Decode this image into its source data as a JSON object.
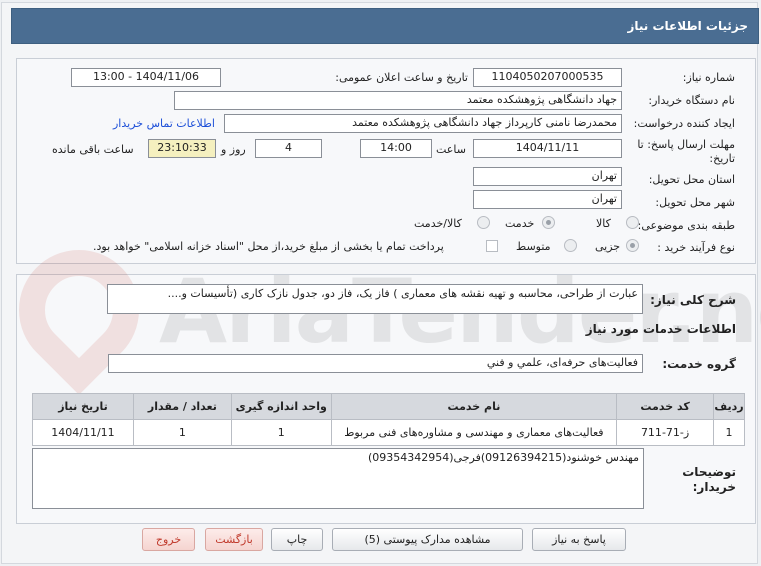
{
  "header": {
    "title": "جزئیات اطلاعات نیاز"
  },
  "fields": {
    "need_number_label": "شماره نیاز:",
    "need_number": "1104050207000535",
    "announce_label": "تاریخ و ساعت اعلان عمومی:",
    "announce_value": "1404/11/06 - 13:00",
    "buyer_org_label": "نام دستگاه خریدار:",
    "buyer_org": "جهاد دانشگاهی پژوهشکده معتمد",
    "creator_label": "ایجاد کننده درخواست:",
    "creator": "محمدرضا نامنی کارپرداز جهاد دانشگاهی پژوهشکده معتمد",
    "contact_link": "اطلاعات تماس خریدار",
    "deadline_label_1": "مهلت ارسال پاسخ: تا",
    "deadline_label_2": "تاریخ:",
    "deadline_date": "1404/11/11",
    "time_label": "ساعت",
    "deadline_time": "14:00",
    "days_value": "4",
    "days_label": "روز و",
    "remaining_time": "23:10:33",
    "remaining_label": "ساعت باقی مانده",
    "province_label": "استان محل تحویل:",
    "province": "تهران",
    "city_label": "شهر محل تحویل:",
    "city": "تهران",
    "category_label": "طبقه بندی موضوعی:",
    "category_options": [
      "کالا",
      "خدمت",
      "کالا/خدمت"
    ],
    "category_selected": "خدمت",
    "process_label": "نوع فرآیند خرید :",
    "process_options": [
      "جزیی",
      "متوسط"
    ],
    "process_selected": "جزیی",
    "payment_note": "پرداخت تمام یا بخشی از مبلغ خرید،از محل \"اسناد خزانه اسلامی\" خواهد بود."
  },
  "description": {
    "label": "شرح کلی نیاز:",
    "text": "عبارت از طراحی، محاسبه و تهیه نقشه های معماری ) فاز یک، فاز دو، جدول نازک کاری (تأسیسات و...."
  },
  "services": {
    "section_title": "اطلاعات خدمات مورد نیاز",
    "group_label": "گروه خدمت:",
    "group_value": "فعالیت‌های حرفه‌ای، علمي و فني",
    "columns": [
      "ردیف",
      "کد خدمت",
      "نام خدمت",
      "واحد اندازه گیری",
      "تعداد / مقدار",
      "تاریخ نیاز"
    ],
    "rows": [
      [
        "1",
        "ز-71-711",
        "فعالیت‌های معماری و مهندسی و مشاوره‌های فنی مربوط",
        "1",
        "1",
        "1404/11/11"
      ]
    ]
  },
  "buyer_notes": {
    "label_1": "توضیحات",
    "label_2": "خریدار:",
    "text": "مهندس خوشنود(09126394215)فرجی(09354342954)"
  },
  "buttons": {
    "reply": "پاسخ به نیاز",
    "attachments": "مشاهده مدارک پیوستی (5)",
    "print": "چاپ",
    "back": "بازگشت",
    "exit": "خروج"
  },
  "watermark": "AriaTender.net"
}
